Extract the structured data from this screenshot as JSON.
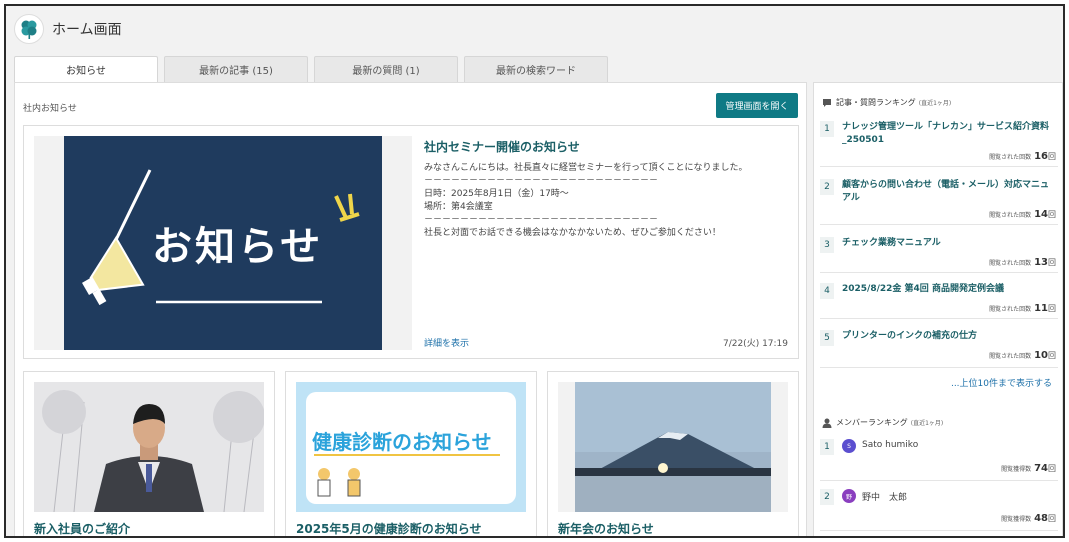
{
  "header": {
    "title": "ホーム画面",
    "logo_icon": "clover-logo-icon"
  },
  "tabs": [
    {
      "label": "お知らせ",
      "active": true
    },
    {
      "label": "最新の記事 (15)",
      "active": false
    },
    {
      "label": "最新の質問 (1)",
      "active": false
    },
    {
      "label": "最新の検索ワード",
      "active": false
    }
  ],
  "main": {
    "section_label": "社内お知らせ",
    "admin_button": "管理画面を開く",
    "featured": {
      "banner_text": "お知らせ",
      "title": "社内セミナー開催のお知らせ",
      "body": "みなさんこんにちは。社長直々に経営セミナーを行って頂くことになりました。\n－－－－－－－－－－－－－－－－－－－－－－－－－－\n日時：2025年8月1日（金）17時～\n場所：第4会議室\n－－－－－－－－－－－－－－－－－－－－－－－－－－\n社長と対面でお話できる機会はなかなかないため、ぜひご参加ください！",
      "detail_link": "詳細を表示",
      "date": "7/22(火) 17:19"
    },
    "cards": [
      {
        "title": "新入社員のご紹介"
      },
      {
        "title": "2025年5月の健康診断のお知らせ",
        "image_text": "健康診断のお知らせ"
      },
      {
        "title": "新年会のお知らせ"
      }
    ]
  },
  "sidebar": {
    "ranking": {
      "title": "記事・質問ランキング",
      "period": "(直近1ヶ月)",
      "icon": "chat-bubble-icon",
      "count_label": "閲覧された回数",
      "unit": "回",
      "items": [
        {
          "rank": "1",
          "title": "ナレッジ管理ツール「ナレカン」サービス紹介資料_250501",
          "count": "16"
        },
        {
          "rank": "2",
          "title": "顧客からの問い合わせ（電話・メール）対応マニュアル",
          "count": "14"
        },
        {
          "rank": "3",
          "title": "チェック業務マニュアル",
          "count": "13"
        },
        {
          "rank": "4",
          "title": "2025/8/22金 第4回 商品開発定例会議",
          "count": "11"
        },
        {
          "rank": "5",
          "title": "プリンターのインクの補充の仕方",
          "count": "10"
        }
      ],
      "more_link": "...上位10件まで表示する"
    },
    "members": {
      "title": "メンバーランキング",
      "period": "(直近1ヶ月)",
      "icon": "person-icon",
      "count_label": "閲覧獲得数",
      "unit": "回",
      "items": [
        {
          "rank": "1",
          "name": "Sato humiko",
          "avatar": "S",
          "avatar_color": "#5b4fcf",
          "count": "74"
        },
        {
          "rank": "2",
          "name": "野中　太郎",
          "avatar": "野",
          "avatar_color": "#8a3fbf",
          "count": "48"
        }
      ]
    }
  },
  "colors": {
    "accent": "#0f7a85",
    "title_teal": "#1b5f66",
    "banner_navy": "#1f3b5e",
    "link_blue": "#1b6fa8"
  }
}
